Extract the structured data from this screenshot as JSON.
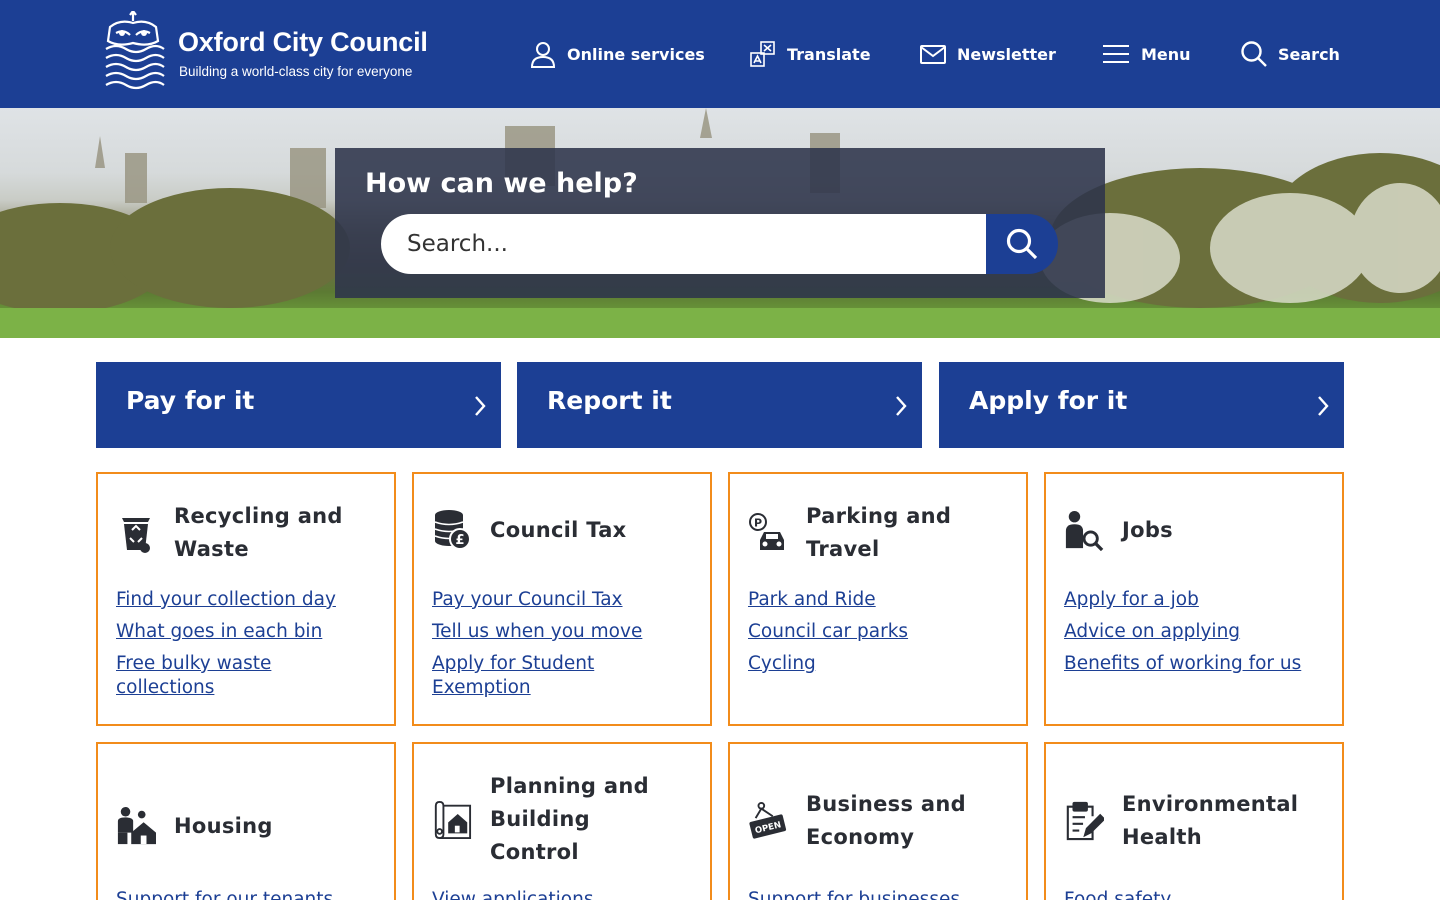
{
  "header": {
    "logo_name": "Oxford City Council",
    "logo_tagline": "Building a world-class city for everyone",
    "nav": [
      {
        "label": "Online services",
        "icon": "user-icon"
      },
      {
        "label": "Translate",
        "icon": "translate-icon"
      },
      {
        "label": "Newsletter",
        "icon": "envelope-icon"
      },
      {
        "label": "Menu",
        "icon": "hamburger-menu-icon"
      },
      {
        "label": "Search",
        "icon": "search-icon"
      }
    ]
  },
  "hero": {
    "title": "How can we help?",
    "search_placeholder": "Search...",
    "search_value": ""
  },
  "quick_actions": [
    {
      "label": "Pay for it"
    },
    {
      "label": "Report it"
    },
    {
      "label": "Apply for it"
    }
  ],
  "cards": [
    {
      "title": "Recycling and Waste",
      "icon": "recycling-bin-icon",
      "links": [
        "Find your collection day",
        "What goes in each bin",
        "Free bulky waste collections"
      ]
    },
    {
      "title": "Council Tax",
      "icon": "coins-pound-icon",
      "links": [
        "Pay your Council Tax",
        "Tell us when you move",
        "Apply for Student Exemption"
      ]
    },
    {
      "title": "Parking and Travel",
      "icon": "parking-car-icon",
      "links": [
        "Park and Ride",
        "Council car parks",
        "Cycling"
      ]
    },
    {
      "title": "Jobs",
      "icon": "person-search-icon",
      "links": [
        "Apply for a job",
        "Advice on applying",
        "Benefits of working for us"
      ]
    },
    {
      "title": "Housing",
      "icon": "family-house-icon",
      "links": [
        "Support for our tenants"
      ]
    },
    {
      "title": "Planning and Building Control",
      "icon": "plans-house-icon",
      "links": [
        "View applications"
      ]
    },
    {
      "title": "Business and Economy",
      "icon": "open-sign-icon",
      "links": [
        "Support for businesses"
      ]
    },
    {
      "title": "Environmental Health",
      "icon": "clipboard-pen-icon",
      "links": [
        "Food safety"
      ]
    }
  ],
  "colors": {
    "brand_blue": "#1c3f94",
    "card_border_orange": "#f28c1b"
  }
}
